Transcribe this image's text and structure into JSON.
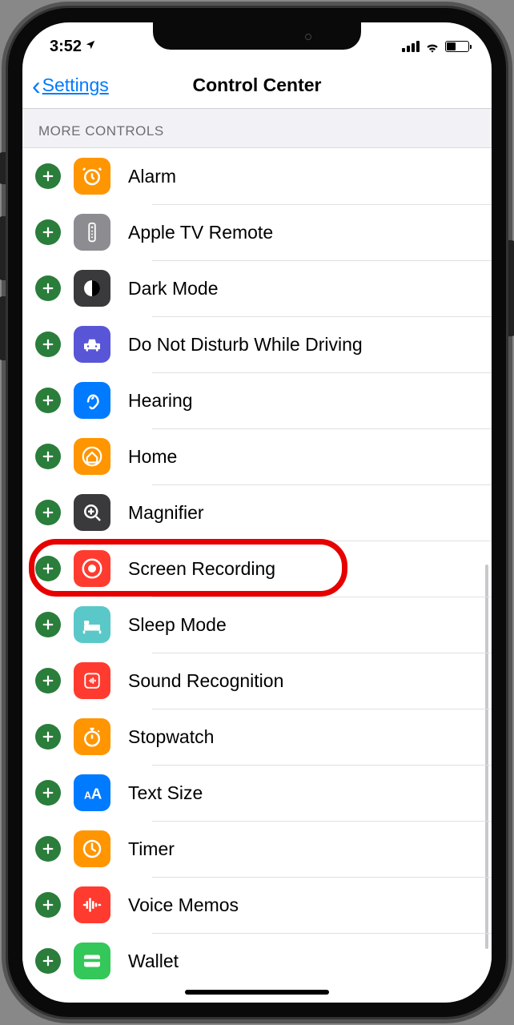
{
  "status": {
    "time": "3:52",
    "location_arrow": "➤"
  },
  "nav": {
    "back_label": "Settings",
    "title": "Control Center"
  },
  "section_header": "MORE CONTROLS",
  "highlighted_item_index": 7,
  "items": [
    {
      "label": "Alarm",
      "icon": "alarm"
    },
    {
      "label": "Apple TV Remote",
      "icon": "tvremote"
    },
    {
      "label": "Dark Mode",
      "icon": "darkmode"
    },
    {
      "label": "Do Not Disturb While Driving",
      "icon": "dnd"
    },
    {
      "label": "Hearing",
      "icon": "hearing"
    },
    {
      "label": "Home",
      "icon": "home"
    },
    {
      "label": "Magnifier",
      "icon": "magnifier"
    },
    {
      "label": "Screen Recording",
      "icon": "screenrec"
    },
    {
      "label": "Sleep Mode",
      "icon": "sleep"
    },
    {
      "label": "Sound Recognition",
      "icon": "sound"
    },
    {
      "label": "Stopwatch",
      "icon": "stopwatch"
    },
    {
      "label": "Text Size",
      "icon": "textsize"
    },
    {
      "label": "Timer",
      "icon": "timer"
    },
    {
      "label": "Voice Memos",
      "icon": "voicememos"
    },
    {
      "label": "Wallet",
      "icon": "wallet"
    }
  ]
}
